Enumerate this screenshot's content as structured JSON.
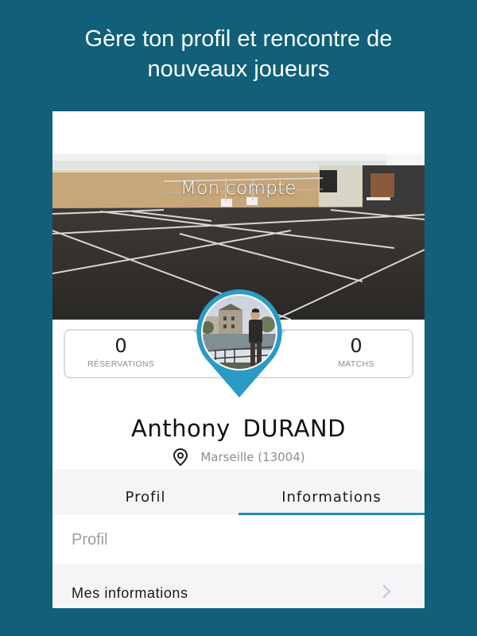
{
  "headline": {
    "line1": "Gère ton profil et rencontre de",
    "line2": "nouveaux joueurs"
  },
  "header": {
    "title": "Mon compte"
  },
  "stats": {
    "reservations_value": "0",
    "reservations_label": "RÉSERVATIONS",
    "matchs_value": "0",
    "matchs_label": "MATCHS"
  },
  "profile": {
    "first_name": "Anthony",
    "last_name": "DURAND",
    "location": "Marseille (13004)"
  },
  "tabs": [
    {
      "label": "Profil",
      "active": false
    },
    {
      "label": "Informations",
      "active": true
    }
  ],
  "section": {
    "title": "Profil"
  },
  "menu": {
    "my_info_label": "Mes informations"
  },
  "colors": {
    "background": "#115f79",
    "accent": "#1e8fb7",
    "pin": "#2a9bc4"
  },
  "icons": [
    "location-pin-icon",
    "chevron-right-icon"
  ]
}
